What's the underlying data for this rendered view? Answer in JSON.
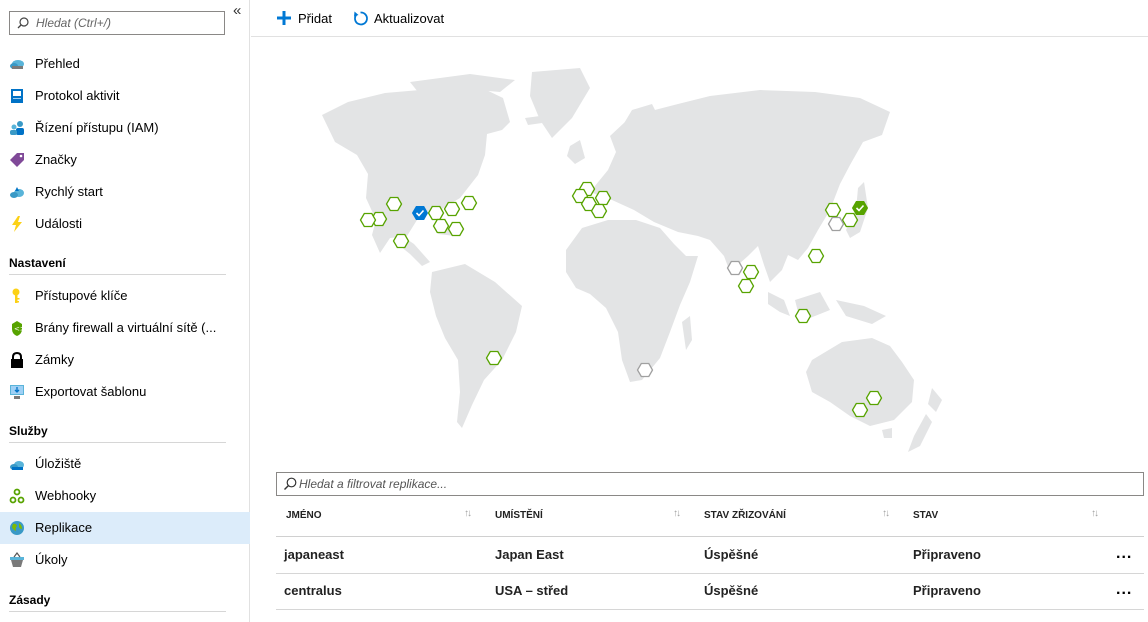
{
  "sidebar": {
    "search_placeholder": "Hledat (Ctrl+/)",
    "collapse_glyph": "«",
    "items": [
      {
        "label": "Přehled",
        "icon": "overview-cloud-icon"
      },
      {
        "label": "Protokol aktivit",
        "icon": "activity-log-icon"
      },
      {
        "label": "Řízení přístupu (IAM)",
        "icon": "iam-users-icon"
      },
      {
        "label": "Značky",
        "icon": "tag-icon"
      },
      {
        "label": "Rychlý start",
        "icon": "quickstart-cloud-icon"
      },
      {
        "label": "Události",
        "icon": "lightning-icon"
      }
    ],
    "section_settings": "Nastavení",
    "settings_items": [
      {
        "label": "Přístupové klíče",
        "icon": "key-icon"
      },
      {
        "label": "Brány firewall a virtuální sítě (...",
        "icon": "firewall-shield-icon"
      },
      {
        "label": "Zámky",
        "icon": "lock-icon"
      },
      {
        "label": "Exportovat šablonu",
        "icon": "export-template-icon"
      }
    ],
    "section_services": "Služby",
    "services_items": [
      {
        "label": "Úložiště",
        "icon": "storage-cloud-icon"
      },
      {
        "label": "Webhooky",
        "icon": "webhook-icon"
      },
      {
        "label": "Replikace",
        "icon": "globe-icon",
        "selected": true
      },
      {
        "label": "Úkoly",
        "icon": "tasks-basket-icon"
      }
    ],
    "section_policies": "Zásady"
  },
  "toolbar": {
    "add_label": "Přidat",
    "refresh_label": "Aktualizovat"
  },
  "filter": {
    "placeholder": "Hledat a filtrovat replikace..."
  },
  "table": {
    "columns": [
      "JMÉNO",
      "UMÍSTĚNÍ",
      "STAV ZŘIZOVÁNÍ",
      "STAV"
    ],
    "rows": [
      {
        "name": "japaneast",
        "location": "Japan East",
        "provisioning": "Úspěšné",
        "status": "Připraveno"
      },
      {
        "name": "centralus",
        "location": "USA – střed",
        "provisioning": "Úspěšné",
        "status": "Připraveno"
      }
    ],
    "more_glyph": "..."
  },
  "colors": {
    "accent": "#0078d4",
    "available_region": "#57a300",
    "unavailable_region": "#a0a0a0",
    "selected_nav": "#dcecfa",
    "map_land": "#e3e4e5"
  }
}
